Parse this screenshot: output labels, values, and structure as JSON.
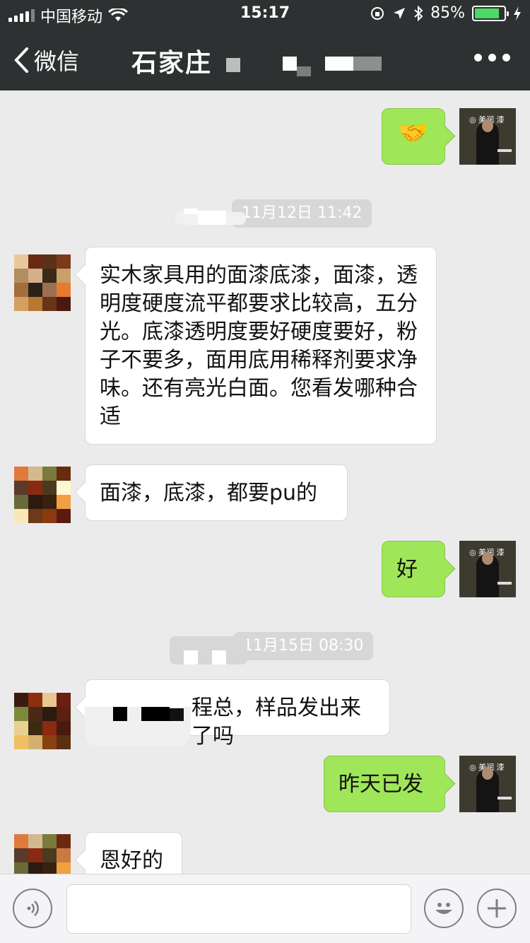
{
  "status": {
    "carrier": "中国移动",
    "time": "15:17",
    "battery": "85%",
    "battery_level": 0.85
  },
  "nav": {
    "back_label": "微信",
    "title": "石家庄"
  },
  "messages": [
    {
      "side": "right",
      "type": "emoji",
      "text": "🤝"
    },
    {
      "side": "time",
      "text": "11月12日 11:42"
    },
    {
      "side": "left",
      "text": "实木家具用的面漆底漆，面漆，透明度硬度流平都要求比较高，五分光。底漆透明度要好硬度要好，粉子不要多，面用底用稀释剂要求净味。还有亮光白面。您看发哪种合适"
    },
    {
      "side": "left",
      "text": "面漆，底漆，都要pu的"
    },
    {
      "side": "right",
      "text": "好"
    },
    {
      "side": "time",
      "text": "11月15日 08:30"
    },
    {
      "side": "left",
      "text": "程总，样品发出来了吗"
    },
    {
      "side": "right",
      "text": "昨天已发"
    },
    {
      "side": "left",
      "text": "恩好的"
    }
  ],
  "self_avatar_brand": "◎ 美润 漆",
  "colors": {
    "header": "#2e3132",
    "chat_bg": "#ebebeb",
    "bubble_self": "#9fe659",
    "bubble_other": "#ffffff",
    "battery_fill": "#4cd964"
  },
  "icons": {
    "back": "chevron-left-icon",
    "more": "more-dots-icon",
    "voice": "voice-icon",
    "emoji": "emoji-icon",
    "plus": "plus-icon"
  }
}
